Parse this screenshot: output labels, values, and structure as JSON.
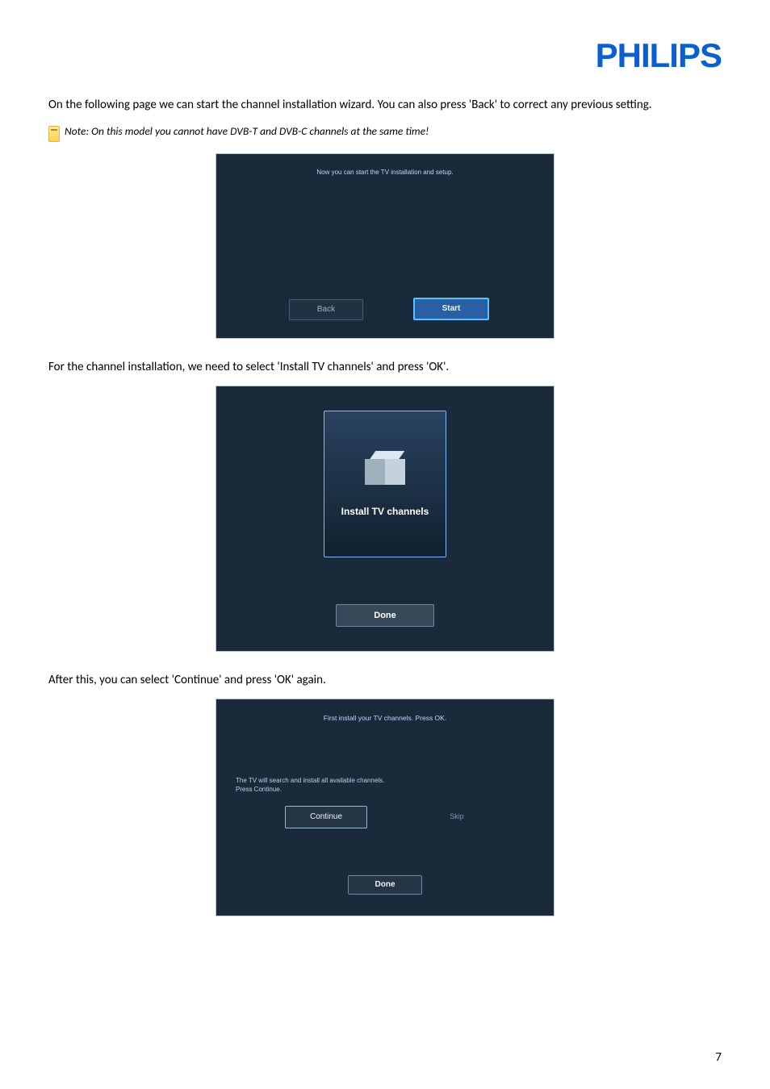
{
  "logo": "PHILIPS",
  "paragraphs": {
    "p1": "On the following page we can start the channel installation wizard. You can also press 'Back' to correct any previous setting.",
    "p2": "For the channel installation, we need to select 'Install TV channels' and press 'OK'.",
    "p3": "After this, you can select 'Continue' and press 'OK' again."
  },
  "note": {
    "text": "Note: On this model you cannot have DVB-T and DVB-C channels at the same time!"
  },
  "screenshot1": {
    "title": "Now you can start the TV installation and setup.",
    "back": "Back",
    "start": "Start"
  },
  "screenshot2": {
    "card_label": "Install TV channels",
    "done": "Done"
  },
  "screenshot3": {
    "title": "First install your TV channels. Press OK.",
    "hint_line1": "The TV will search and install all available channels.",
    "hint_line2": "Press Continue.",
    "continue": "Continue",
    "skip": "Skip",
    "done": "Done"
  },
  "page_number": "7"
}
